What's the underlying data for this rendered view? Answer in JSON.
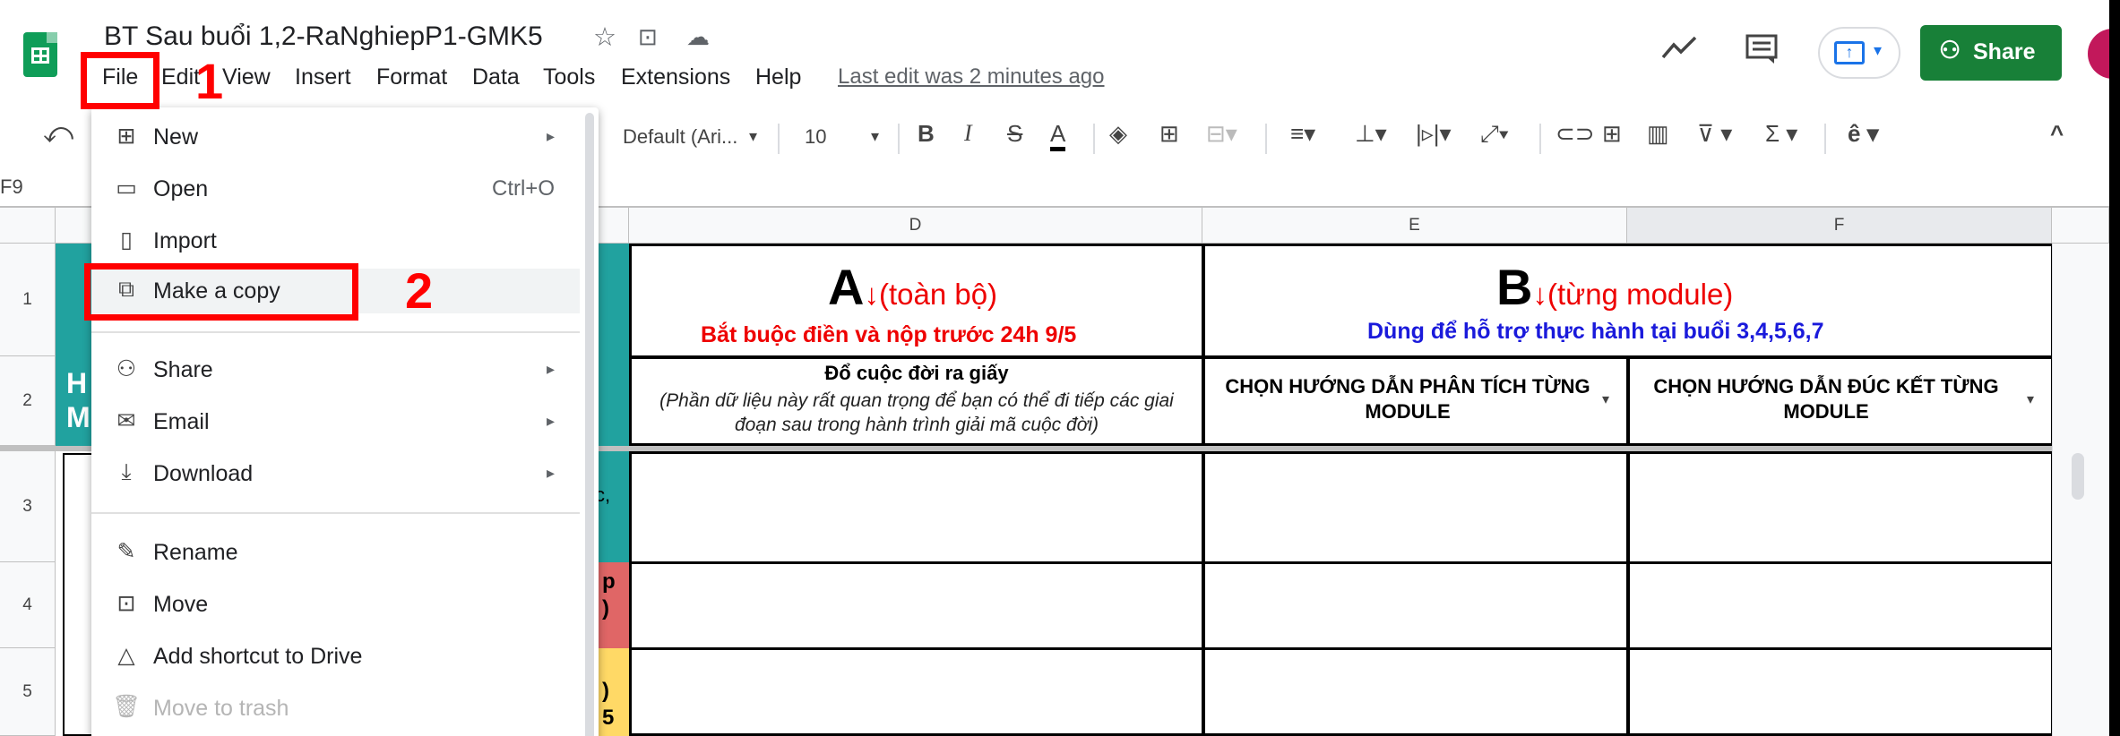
{
  "header": {
    "doc_title": "BT Sau buổi 1,2-RaNghiepP1-GMK5",
    "star_icon": "☆",
    "move_icon": "⊡",
    "cloud_icon": "☁",
    "menu": [
      "File",
      "Edit",
      "View",
      "Insert",
      "Format",
      "Data",
      "Tools",
      "Extensions",
      "Help"
    ],
    "last_edit": "Last edit was 2 minutes ago",
    "share_label": "Share"
  },
  "toolbar": {
    "undo_icon": "⤺",
    "font": "Default (Ari...",
    "font_size": "10",
    "bold": "B",
    "italic": "I",
    "strike": "S",
    "text_color": "A",
    "collapse": "^",
    "name_box": "F9"
  },
  "sheet": {
    "columns": [
      "D",
      "E",
      "F"
    ],
    "rows": [
      "1",
      "2",
      "3",
      "4",
      "5"
    ],
    "d1_letter": "A",
    "d1_sub": "↓(toàn bộ)",
    "d1_line": "Bắt buộc điền và nộp trước 24h 9/5",
    "e1_letter": "B",
    "e1_sub": "↓(từng module)",
    "e1_line": "Dùng để hỗ trợ thực hành tại buổi 3,4,5,6,7",
    "d2_title": "Đổ cuộc đời ra giấy",
    "d2_note": "(Phần dữ liệu này rất quan trọng để bạn có thể đi tiếp các giai đoạn sau trong hành trình giải mã cuộc đời)",
    "e2_text": "CHỌN HƯỚNG DẪN PHÂN TÍCH TỪNG MODULE",
    "f2_text": "CHỌN HƯỚNG DẪN ĐÚC KẾT TỪNG MODULE",
    "left_fragments": [
      "H",
      "M",
      "c,",
      "p",
      ")",
      ")",
      "5"
    ]
  },
  "file_menu": {
    "items": [
      {
        "label": "New",
        "icon": "new-sheet-icon",
        "arrow": "▸"
      },
      {
        "label": "Open",
        "icon": "folder-icon",
        "shortcut": "Ctrl+O"
      },
      {
        "label": "Import",
        "icon": "import-file-icon"
      },
      {
        "label": "Make a copy",
        "icon": "copy-icon"
      },
      {
        "label": "Share",
        "icon": "share-person-icon",
        "arrow": "▸"
      },
      {
        "label": "Email",
        "icon": "email-icon",
        "arrow": "▸"
      },
      {
        "label": "Download",
        "icon": "download-icon",
        "arrow": "▸"
      },
      {
        "label": "Rename",
        "icon": "rename-icon"
      },
      {
        "label": "Move",
        "icon": "move-icon"
      },
      {
        "label": "Add shortcut to Drive",
        "icon": "drive-shortcut-icon"
      },
      {
        "label": "Move to trash",
        "icon": "trash-icon",
        "disabled": true
      }
    ]
  },
  "annotations": {
    "step1": "1",
    "step2": "2",
    "color": "#ff0000"
  },
  "colors": {
    "teal": "#21a29f",
    "salmon": "#e06666",
    "yellow": "#ffd966",
    "share_green": "#188038"
  }
}
